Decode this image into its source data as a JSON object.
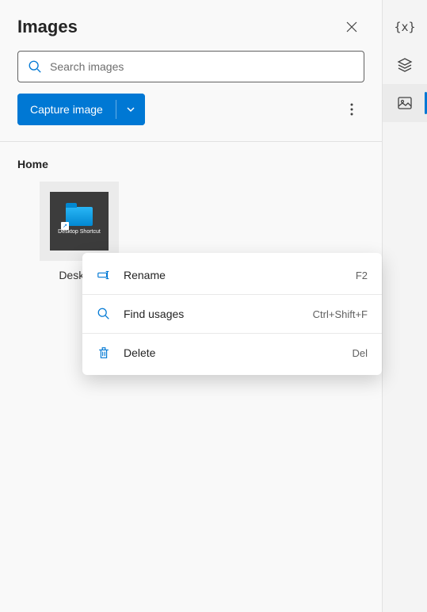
{
  "panel": {
    "title": "Images"
  },
  "search": {
    "placeholder": "Search images",
    "value": ""
  },
  "toolbar": {
    "capture_label": "Capture image"
  },
  "section": {
    "label": "Home"
  },
  "item": {
    "inner_text": "Desktop Shortcut",
    "caption": "Desktop"
  },
  "context_menu": {
    "rename": {
      "label": "Rename",
      "shortcut": "F2"
    },
    "find": {
      "label": "Find usages",
      "shortcut": "Ctrl+Shift+F"
    },
    "delete": {
      "label": "Delete",
      "shortcut": "Del"
    }
  },
  "rail": {
    "variables_icon": "{x}",
    "layers_icon": "layers",
    "images_icon": "image"
  }
}
